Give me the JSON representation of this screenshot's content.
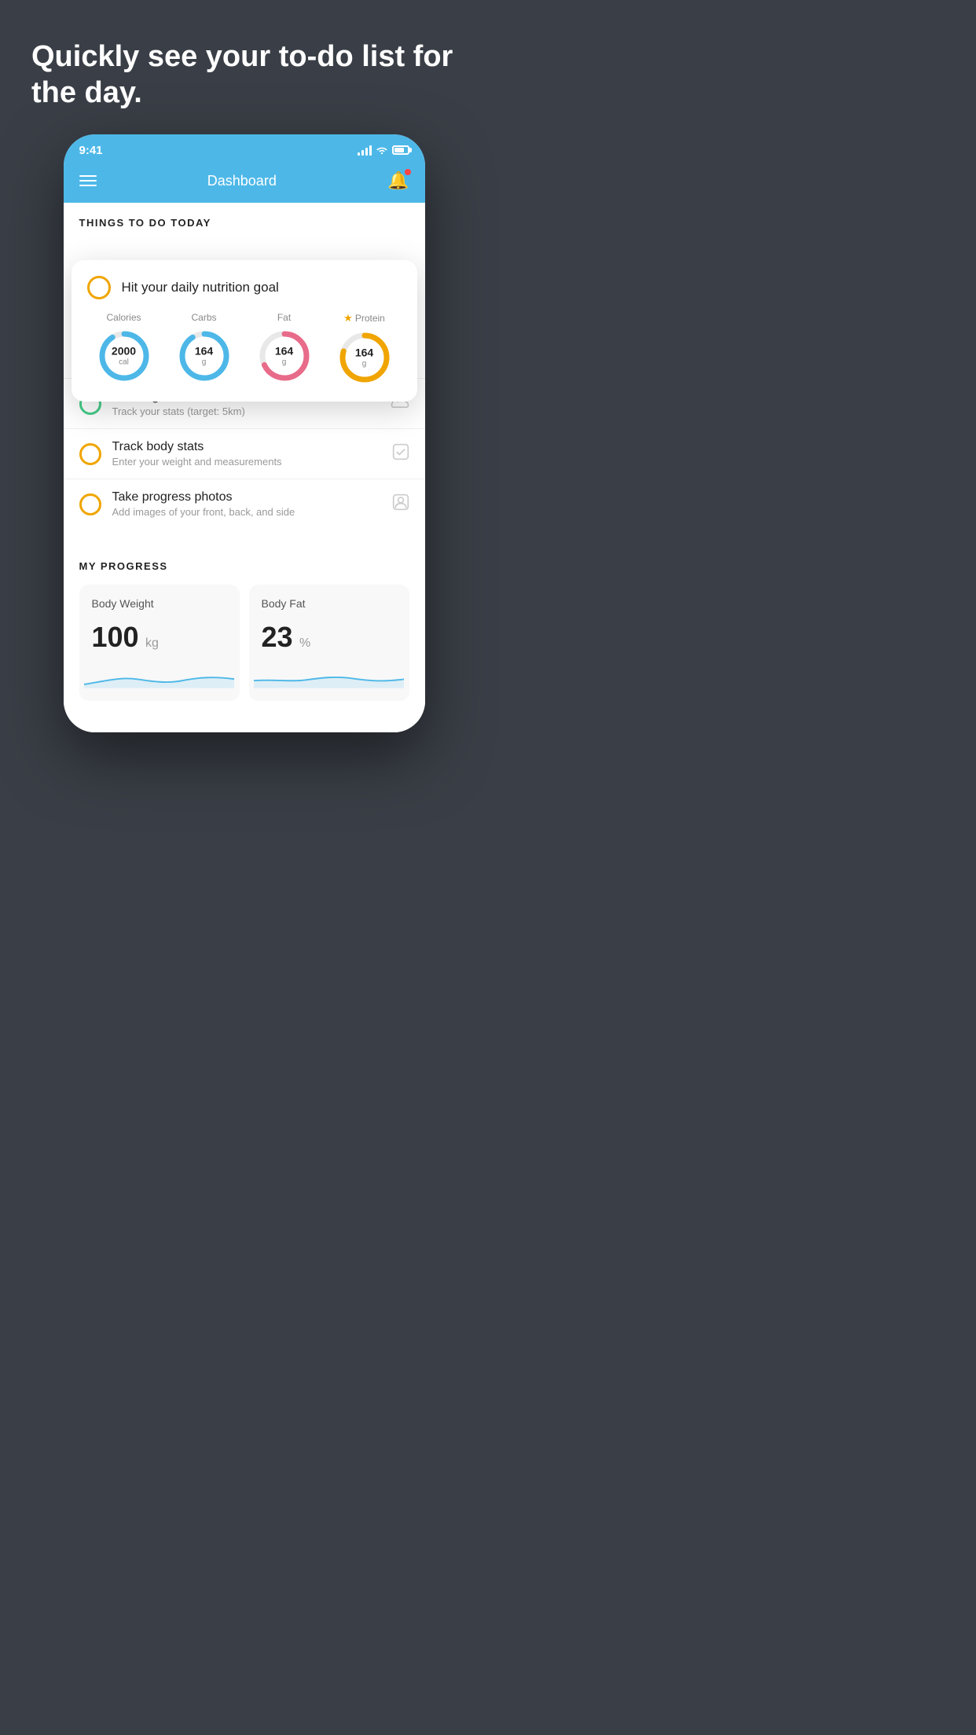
{
  "hero": {
    "headline": "Quickly see your to-do list for the day."
  },
  "statusBar": {
    "time": "9:41"
  },
  "navBar": {
    "title": "Dashboard"
  },
  "thingsToDo": {
    "sectionTitle": "THINGS TO DO TODAY",
    "popupCard": {
      "title": "Hit your daily nutrition goal",
      "nutrients": [
        {
          "label": "Calories",
          "value": "2000",
          "unit": "cal",
          "color": "blue",
          "star": false
        },
        {
          "label": "Carbs",
          "value": "164",
          "unit": "g",
          "color": "blue",
          "star": false
        },
        {
          "label": "Fat",
          "value": "164",
          "unit": "g",
          "color": "pink",
          "star": false
        },
        {
          "label": "Protein",
          "value": "164",
          "unit": "g",
          "color": "gold",
          "star": true
        }
      ]
    },
    "listItems": [
      {
        "title": "Running",
        "subtitle": "Track your stats (target: 5km)",
        "circleColor": "green"
      },
      {
        "title": "Track body stats",
        "subtitle": "Enter your weight and measurements",
        "circleColor": "yellow"
      },
      {
        "title": "Take progress photos",
        "subtitle": "Add images of your front, back, and side",
        "circleColor": "yellow"
      }
    ]
  },
  "myProgress": {
    "sectionTitle": "MY PROGRESS",
    "cards": [
      {
        "title": "Body Weight",
        "value": "100",
        "unit": "kg"
      },
      {
        "title": "Body Fat",
        "value": "23",
        "unit": "%"
      }
    ]
  }
}
